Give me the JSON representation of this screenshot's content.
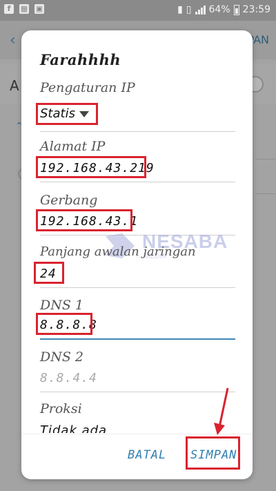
{
  "status_bar": {
    "left_icons": [
      "facebook-icon",
      "image-icon",
      "gallery-icon"
    ],
    "battery_percent": "64%",
    "time": "23:59"
  },
  "background": {
    "header_action": "PAN",
    "row_label": "A"
  },
  "dialog": {
    "title": "Farahhhh",
    "ip_settings_label": "Pengaturan IP",
    "ip_settings_value": "Statis",
    "ip_address_label": "Alamat IP",
    "ip_address_value": "192.168.43.219",
    "gateway_label": "Gerbang",
    "gateway_value": "192.168.43.1",
    "prefix_label": "Panjang awalan jaringan",
    "prefix_value": "24",
    "dns1_label": "DNS 1",
    "dns1_value": "8.8.8.8",
    "dns2_label": "DNS 2",
    "dns2_placeholder": "8.8.4.4",
    "proxy_label": "Proksi",
    "proxy_value": "Tidak ada"
  },
  "buttons": {
    "cancel": "BATAL",
    "save": "SIMPAN"
  },
  "watermark": {
    "brand": "NESABA",
    "tagline": "MEDIA"
  },
  "colors": {
    "highlight": "#d9232e",
    "accent": "#2f7fb0"
  }
}
